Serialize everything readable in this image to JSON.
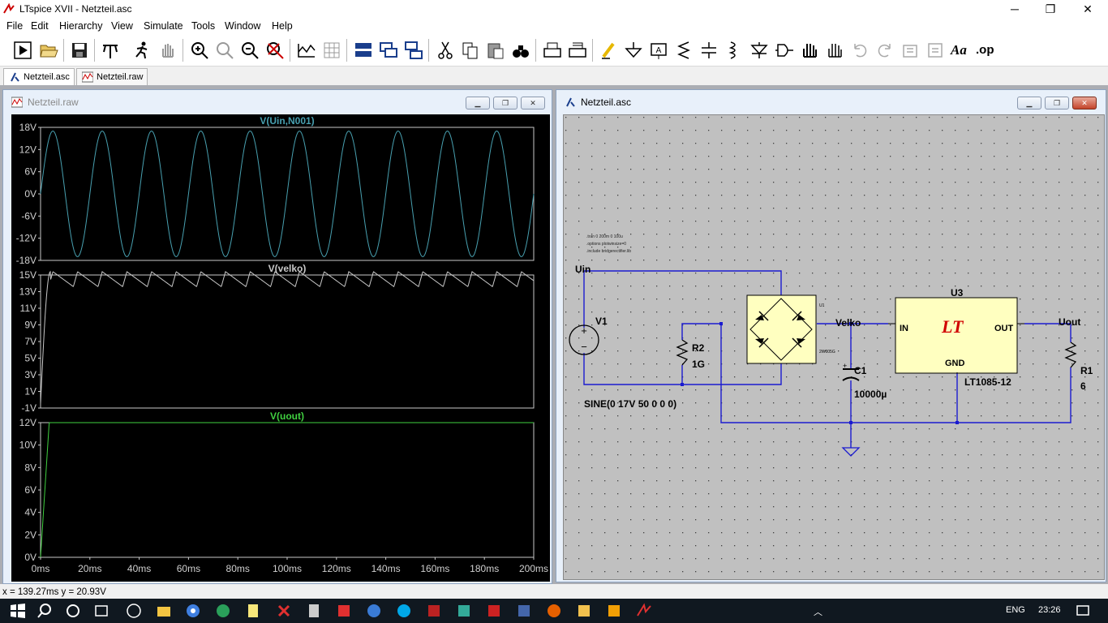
{
  "window": {
    "title": "LTspice XVII - Netzteil.asc",
    "minimize_glyph": "─",
    "maximize_glyph": "❐",
    "close_glyph": "✕"
  },
  "menu": [
    "File",
    "Edit",
    "Hierarchy",
    "View",
    "Simulate",
    "Tools",
    "Window",
    "Help"
  ],
  "toolbar": [
    "run-icon",
    "open-icon",
    "save-icon",
    "control-panel-icon",
    "halt-icon",
    "pan-icon",
    "zoom-in-icon",
    "zoom-full-icon",
    "zoom-out-icon",
    "zoom-cancel-icon",
    "autorange-icon",
    "grid-icon",
    "tile-horizontal-icon",
    "cascade-icon",
    "tile-vertical-icon",
    "cut-icon",
    "copy-icon",
    "paste-icon",
    "find-icon",
    "print-icon",
    "print-setup-icon",
    "draw-wire-icon",
    "ground-icon",
    "label-net-icon",
    "resistor-icon",
    "capacitor-icon",
    "inductor-icon",
    "diode-icon",
    "component-icon",
    "move-icon",
    "drag-icon",
    "undo-icon",
    "redo-icon",
    "rotate-icon",
    "mirror-icon",
    "text-icon",
    "spice-directive-icon"
  ],
  "toolbar_text": {
    "text_tool": "Aa",
    "spice_directive": ".op"
  },
  "tabs": [
    {
      "label": "Netzteil.asc",
      "active": true
    },
    {
      "label": "Netzteil.raw",
      "active": false
    }
  ],
  "waveform_window": {
    "title": "Netzteil.raw"
  },
  "schematic_window": {
    "title": "Netzteil.asc"
  },
  "chart_data": [
    {
      "type": "line",
      "title": "V(Uin,N001)",
      "color": "#48a0b0",
      "x": [
        0,
        200
      ],
      "xlabel": "",
      "ylim": [
        -18,
        18
      ],
      "yticks": [
        "18V",
        "12V",
        "6V",
        "0V",
        "-6V",
        "-12V",
        "-18V"
      ],
      "series": [
        {
          "name": "V(Uin,N001)",
          "amplitude": 17,
          "frequency_hz": 50
        }
      ]
    },
    {
      "type": "line",
      "title": "V(velko)",
      "color": "#c8c8c8",
      "ylim": [
        -1,
        15
      ],
      "yticks": [
        "15V",
        "13V",
        "11V",
        "9V",
        "7V",
        "5V",
        "3V",
        "1V",
        "-1V"
      ],
      "series": [
        {
          "name": "V(velko)",
          "peak": 15.4,
          "ripple_min": 13.6
        }
      ]
    },
    {
      "type": "line",
      "title": "V(uout)",
      "color": "#40d040",
      "ylim": [
        0,
        12
      ],
      "yticks": [
        "12V",
        "10V",
        "8V",
        "6V",
        "4V",
        "2V",
        "0V"
      ],
      "xticks": [
        "0ms",
        "20ms",
        "40ms",
        "60ms",
        "80ms",
        "100ms",
        "120ms",
        "140ms",
        "160ms",
        "180ms",
        "200ms"
      ],
      "series": [
        {
          "name": "V(uout)",
          "final": 12
        }
      ]
    }
  ],
  "schematic": {
    "directives": [
      ".tran 0 200m 0 100u",
      ".options plotwinsize=0",
      ".include bridgerectifier.lib"
    ],
    "labels": {
      "uin": "Uin",
      "velko": "Velko",
      "uout": "Uout"
    },
    "v1": {
      "name": "V1",
      "value": "SINE(0 17V 50 0 0 0)"
    },
    "r2": {
      "name": "R2",
      "value": "1G"
    },
    "c1": {
      "name": "C1",
      "value": "10000µ"
    },
    "r1": {
      "name": "R1",
      "value": "6"
    },
    "u1": {
      "name": "U1",
      "part": "2W005G"
    },
    "u3": {
      "name": "U3",
      "part": "LT1085-12",
      "in": "IN",
      "out": "OUT",
      "gnd": "GND",
      "logo": "LT"
    }
  },
  "status": "x = 139.27ms    y = 20.93V",
  "taskbar": {
    "lang": "ENG",
    "time": "23:26"
  }
}
